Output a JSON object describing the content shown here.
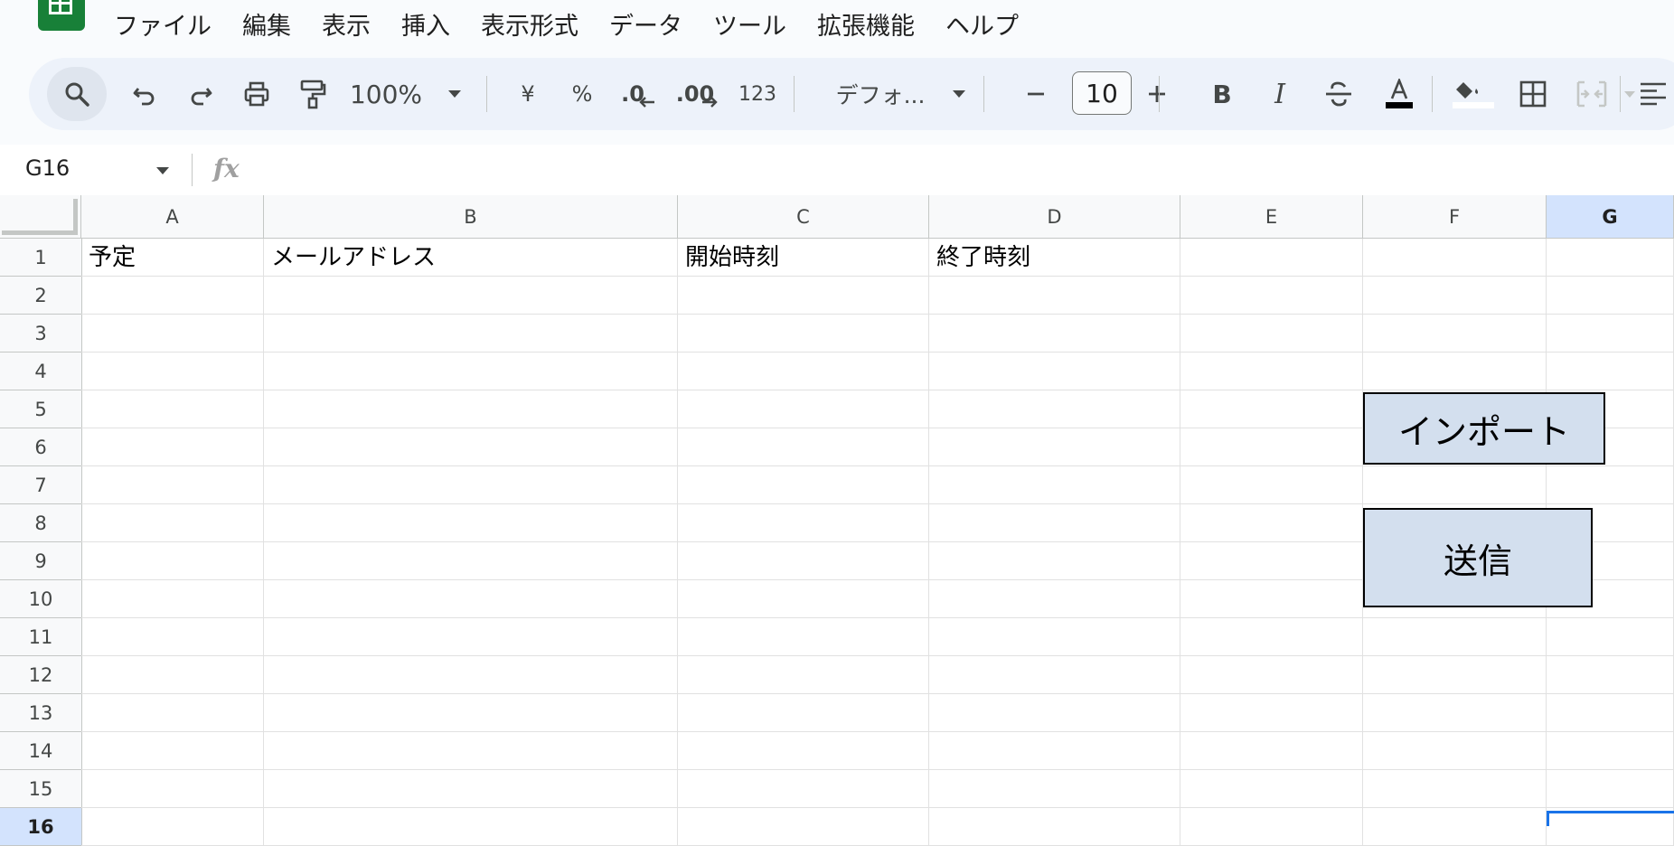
{
  "menu": [
    "ファイル",
    "編集",
    "表示",
    "挿入",
    "表示形式",
    "データ",
    "ツール",
    "拡張機能",
    "ヘルプ"
  ],
  "toolbar": {
    "zoom": "100%",
    "currency": "¥",
    "percent": "%",
    "decrease_decimal": ".0",
    "increase_decimal": ".00",
    "number_format": "123",
    "font": "デフォ...",
    "font_size": "10",
    "bold": "B",
    "italic": "I",
    "text_color": "#000000"
  },
  "formula_bar": {
    "cell_ref": "G16",
    "fx": "fx"
  },
  "columns": [
    "A",
    "B",
    "C",
    "D",
    "E",
    "F",
    "G"
  ],
  "selected_column": "G",
  "rows": [
    "1",
    "2",
    "3",
    "4",
    "5",
    "6",
    "7",
    "8",
    "9",
    "10",
    "11",
    "12",
    "13",
    "14",
    "15",
    "16"
  ],
  "selected_row": "16",
  "cells": {
    "A1": "予定",
    "B1": "メールアドレス",
    "C1": "開始時刻",
    "D1": "終了時刻"
  },
  "buttons": {
    "import": "インポート",
    "send": "送信"
  },
  "colors": {
    "button_fill": "#d3dfee",
    "selection": "#1a73e8",
    "header_selected": "#d3e3fd"
  }
}
